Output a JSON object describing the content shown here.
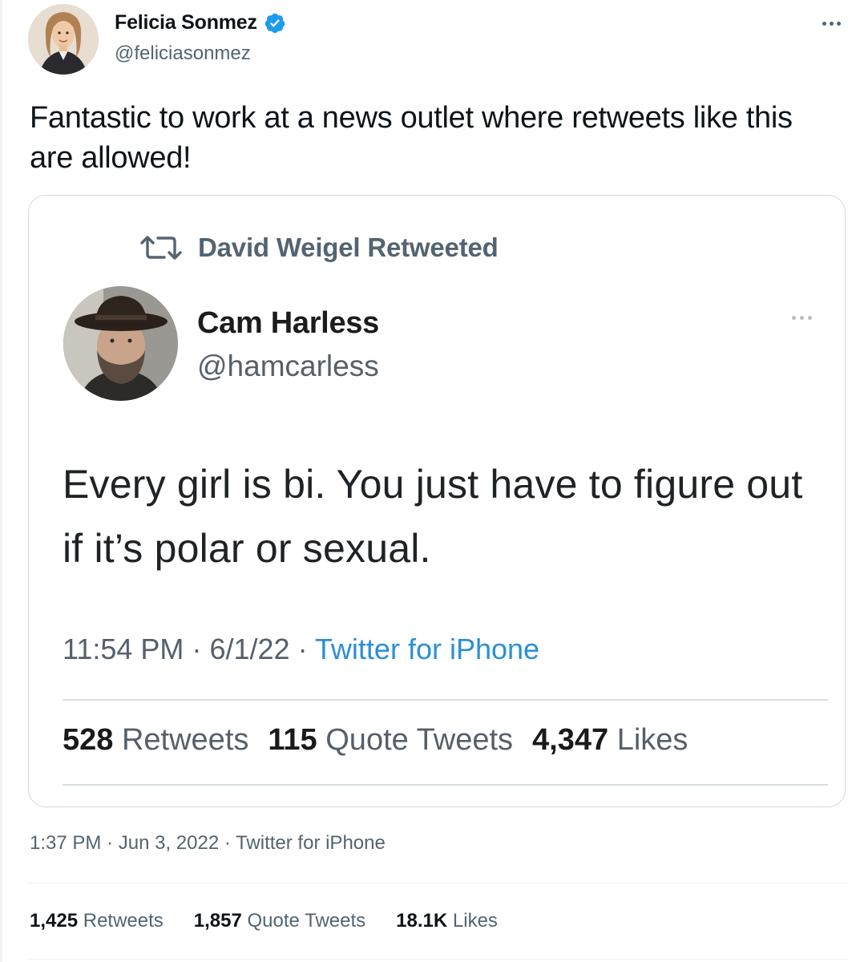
{
  "author": {
    "display_name": "Felicia Sonmez",
    "handle": "@feliciasonmez",
    "verified": true,
    "avatar_icon": "profile-photo"
  },
  "tweet": {
    "text": "Fantastic to work at a news outlet where retweets like this are allowed!",
    "time": "1:37 PM",
    "date": "Jun 3, 2022",
    "source": "Twitter for iPhone",
    "sep": "·"
  },
  "stats": {
    "retweets_count": "1,425",
    "retweets_label": "Retweets",
    "quotes_count": "1,857",
    "quotes_label": "Quote Tweets",
    "likes_count": "18.1K",
    "likes_label": "Likes"
  },
  "embedded": {
    "retweeted_by": "David Weigel Retweeted",
    "display_name": "Cam Harless",
    "handle": "@hamcarless",
    "text": "Every girl is bi. You just have to figure out if it’s polar or sexual.",
    "time": "11:54 PM",
    "date": "6/1/22",
    "source": "Twitter for iPhone",
    "sep": "·",
    "retweets_count": "528",
    "retweets_label": "Retweets",
    "quotes_count": "115",
    "quotes_label": "Quote Tweets",
    "likes_count": "4,347",
    "likes_label": "Likes"
  },
  "colors": {
    "verified_blue": "#1d9bf0",
    "link_blue": "#2a8fd8",
    "secondary_text": "#536471"
  }
}
